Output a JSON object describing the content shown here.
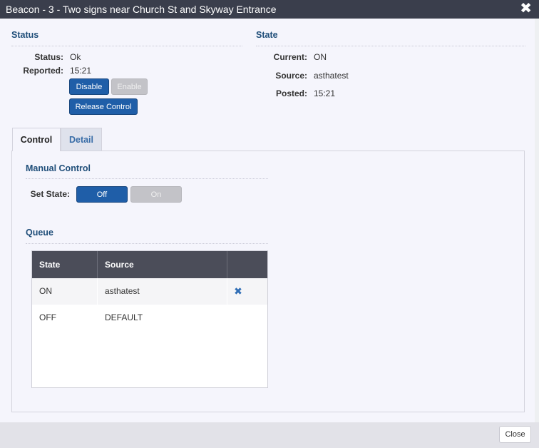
{
  "window": {
    "title": "Beacon - 3 - Two signs near Church St and Skyway Entrance",
    "close_glyph": "✖"
  },
  "status": {
    "heading": "Status",
    "status_label": "Status:",
    "status_value": "Ok",
    "reported_label": "Reported:",
    "reported_value": "15:21",
    "disable_label": "Disable",
    "enable_label": "Enable",
    "release_label": "Release Control"
  },
  "state": {
    "heading": "State",
    "current_label": "Current:",
    "current_value": "ON",
    "source_label": "Source:",
    "source_value": "asthatest",
    "posted_label": "Posted:",
    "posted_value": "15:21"
  },
  "tabs": [
    {
      "label": "Control",
      "active": true
    },
    {
      "label": "Detail",
      "active": false
    }
  ],
  "manual_control": {
    "heading": "Manual Control",
    "set_state_label": "Set State:",
    "off_label": "Off",
    "on_label": "On"
  },
  "queue": {
    "heading": "Queue",
    "columns": [
      "State",
      "Source",
      ""
    ],
    "rows": [
      {
        "state": "ON",
        "source": "asthatest",
        "removable": true
      },
      {
        "state": "OFF",
        "source": "DEFAULT",
        "removable": false
      }
    ],
    "remove_glyph": "✖"
  },
  "footer": {
    "close_label": "Close"
  },
  "colors": {
    "titlebar": "#3a3e4c",
    "heading": "#1f4e79",
    "primary": "#1f5ea8",
    "disabled": "#c3c3c8",
    "table_header": "#4b4d59"
  }
}
